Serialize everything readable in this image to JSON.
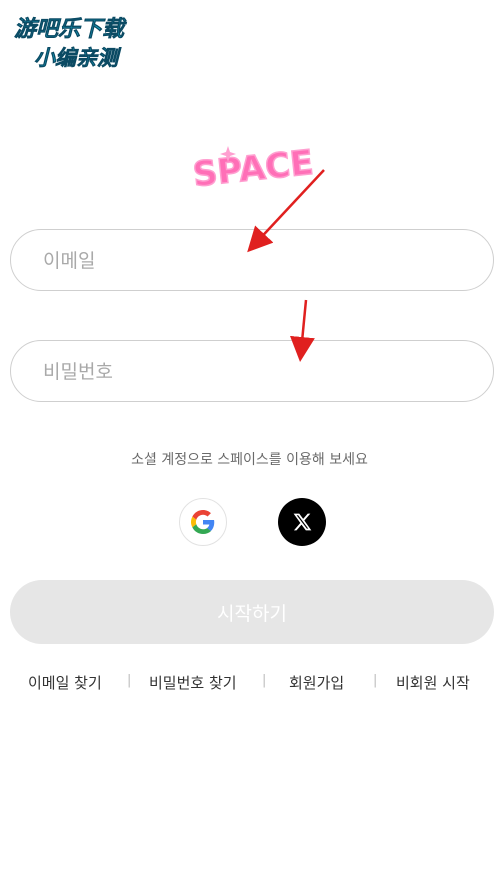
{
  "watermark": {
    "line1": "游吧乐下载",
    "line2": "小编亲测"
  },
  "logo": {
    "text": "SPACE"
  },
  "form": {
    "email_placeholder": "이메일",
    "password_placeholder": "비밀번호"
  },
  "social": {
    "caption": "소셜 계정으로 스페이스를 이용해 보세요",
    "google_icon": "google-icon",
    "x_icon": "x-icon"
  },
  "start_button": {
    "label": "시작하기"
  },
  "links": {
    "find_email": "이메일 찾기",
    "find_password": "비밀번호 찾기",
    "signup": "회원가입",
    "guest_start": "비회원 시작",
    "separator": "|"
  },
  "colors": {
    "logo_pink": "#ff6fb7",
    "watermark_cyan": "#18c8ea",
    "arrow_red": "#e0201f"
  }
}
